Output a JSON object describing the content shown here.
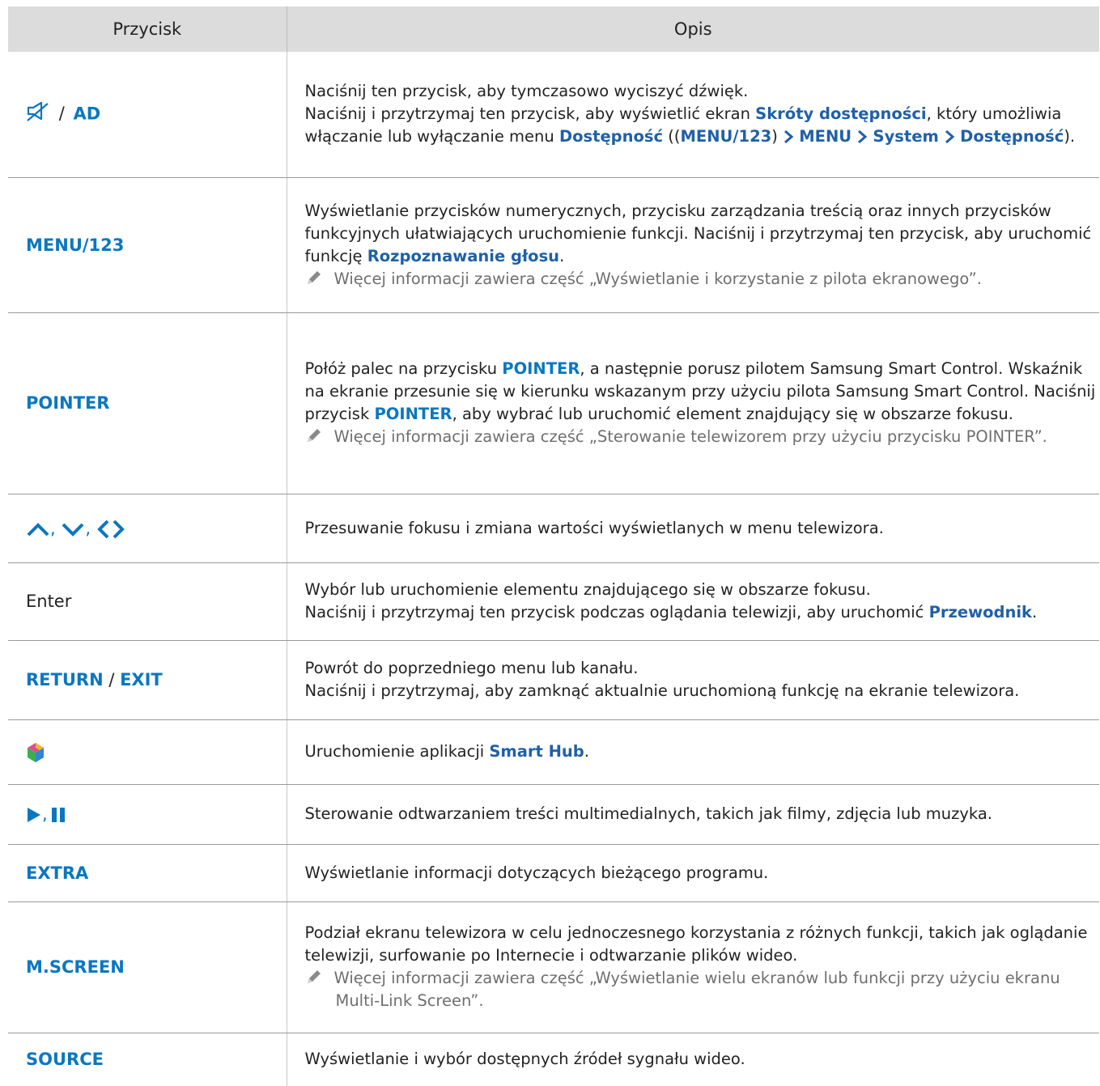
{
  "header": {
    "col1": "Przycisk",
    "col2": "Opis"
  },
  "rows": {
    "r1": {
      "key": [
        "/",
        "AD"
      ],
      "l1": "Naciśnij ten przycisk, aby tymczasowo wyciszyć dźwięk.",
      "l2a": "Naciśnij i przytrzymaj ten przycisk, aby wyświetlić ekran ",
      "l2b": "Skróty dostępności",
      "l2c": ", który umożliwia włączanie lub wyłączanie menu ",
      "l2d": "Dostępność",
      "l2e": " ((",
      "l2f": "MENU/123",
      "l2g": ")",
      "l2h": "MENU",
      "l2i": "System",
      "l2j": "Dostępność",
      "l2k": ")."
    },
    "r2": {
      "key": "MENU/123",
      "t1": "Wyświetlanie przycisków numerycznych, przycisku zarządzania treścią oraz innych przycisków funkcyjnych ułatwiających uruchomienie funkcji. Naciśnij i przytrzymaj ten przycisk, aby uruchomić funkcję ",
      "t2": "Rozpoznawanie głosu",
      "t3": ".",
      "note": "Więcej informacji zawiera część „Wyświetlanie i korzystanie z pilota ekranowego”."
    },
    "r3": {
      "key": "POINTER",
      "t1": "Połóż palec na przycisku ",
      "t2": "POINTER",
      "t3": ", a następnie porusz pilotem Samsung Smart Control. Wskaźnik na ekranie przesunie się w kierunku wskazanym przy użyciu pilota Samsung Smart Control. Naciśnij przycisk ",
      "t4": "POINTER",
      "t5": ", aby wybrać lub uruchomić element znajdujący się w obszarze fokusu.",
      "note": "Więcej informacji zawiera część „Sterowanie telewizorem przy użyciu przycisku POINTER”."
    },
    "r4": {
      "key_icons": [
        "chevron-up-icon",
        "chevron-down-icon",
        "chevron-left-icon",
        "chevron-right-icon"
      ],
      "key_sep": ",",
      "desc": "Przesuwanie fokusu i zmiana wartości wyświetlanych w menu telewizora."
    },
    "r5": {
      "key": "Enter",
      "l1": "Wybór lub uruchomienie elementu znajdującego się w obszarze fokusu.",
      "l2a": "Naciśnij i przytrzymaj ten przycisk podczas oglądania telewizji, aby uruchomić ",
      "l2b": "Przewodnik",
      "l2c": "."
    },
    "r6": {
      "key": [
        "RETURN",
        " / ",
        "EXIT"
      ],
      "l1": "Powrót do poprzedniego menu lub kanału.",
      "l2": "Naciśnij i przytrzymaj, aby zamknąć aktualnie uruchomioną funkcję na ekranie telewizora."
    },
    "r7": {
      "key_icon": "smart-hub-icon",
      "t1": "Uruchomienie aplikacji ",
      "t2": "Smart Hub",
      "t3": "."
    },
    "r8": {
      "key_icons": [
        "play-icon",
        "pause-icon"
      ],
      "key_sep": ",",
      "desc": "Sterowanie odtwarzaniem treści multimedialnych, takich jak filmy, zdjęcia lub muzyka."
    },
    "r9": {
      "key": "EXTRA",
      "desc": "Wyświetlanie informacji dotyczących bieżącego programu."
    },
    "r10": {
      "key": "M.SCREEN",
      "desc": "Podział ekranu telewizora w celu jednoczesnego korzystania z różnych funkcji, takich jak oglądanie telewizji, surfowanie po Internecie i odtwarzanie plików wideo.",
      "note": "Więcej informacji zawiera część „Wyświetlanie wielu ekranów lub funkcji przy użyciu ekranu Multi-Link Screen”."
    },
    "r11": {
      "key": "SOURCE",
      "desc": "Wyświetlanie i wybór dostępnych źródeł sygnału wideo."
    }
  },
  "colors": {
    "header_bg": "#dcdcdc",
    "keyword": "#0a77c1",
    "menu_path": "#1f60a8",
    "note_text": "#6f6f6f"
  }
}
